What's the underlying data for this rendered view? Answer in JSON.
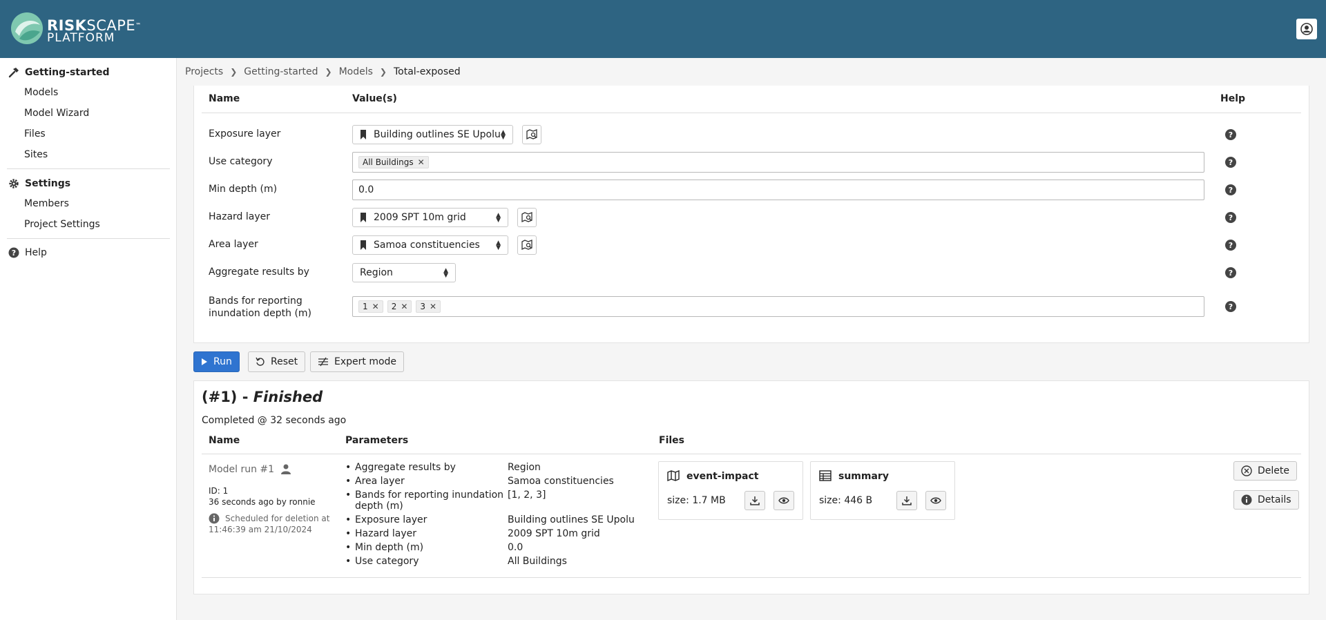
{
  "header": {
    "logo_word1": "RISK",
    "logo_word2": "SCAPE",
    "logo_tm": "™",
    "logo_line2": "PLATFORM"
  },
  "sidebar": {
    "project": "Getting-started",
    "project_items": [
      "Models",
      "Model Wizard",
      "Files",
      "Sites"
    ],
    "settings": "Settings",
    "settings_items": [
      "Members",
      "Project Settings"
    ],
    "help": "Help"
  },
  "breadcrumb": [
    "Projects",
    "Getting-started",
    "Models",
    "Total-exposed"
  ],
  "params_table": {
    "col_name": "Name",
    "col_values": "Value(s)",
    "col_help": "Help",
    "rows": {
      "exposure_layer": {
        "label": "Exposure layer",
        "value": "Building outlines SE Upolu"
      },
      "use_category": {
        "label": "Use category",
        "tags": [
          "All Buildings"
        ]
      },
      "min_depth": {
        "label": "Min depth (m)",
        "value": "0.0"
      },
      "hazard_layer": {
        "label": "Hazard layer",
        "value": "2009 SPT 10m grid"
      },
      "area_layer": {
        "label": "Area layer",
        "value": "Samoa constituencies"
      },
      "aggregate": {
        "label": "Aggregate results by",
        "value": "Region"
      },
      "bands": {
        "label_line1": "Bands for reporting",
        "label_line2": "inundation depth (m)",
        "tags": [
          "1",
          "2",
          "3"
        ]
      }
    },
    "help_glyph": "?"
  },
  "actions": {
    "run": "Run",
    "reset": "Reset",
    "expert": "Expert mode"
  },
  "run": {
    "title_prefix": "(#1) - ",
    "title_status": "Finished",
    "completed": "Completed @ 32 seconds ago",
    "col_name": "Name",
    "col_parameters": "Parameters",
    "col_files": "Files",
    "name": "Model run #1",
    "id": "ID: 1",
    "when": "36 seconds ago by ronnie",
    "deletion_line1": "Scheduled for deletion at",
    "deletion_line2": "11:46:39 am 21/10/2024",
    "parameters": [
      {
        "key": "Aggregate results by",
        "value": "Region"
      },
      {
        "key": "Area layer",
        "value": "Samoa constituencies"
      },
      {
        "key_line1": "Bands for reporting inundation",
        "key_line2": "depth (m)",
        "value": "[1, 2, 3]"
      },
      {
        "key": "Exposure layer",
        "value": "Building outlines SE Upolu"
      },
      {
        "key": "Hazard layer",
        "value": "2009 SPT 10m grid"
      },
      {
        "key": "Min depth (m)",
        "value": "0.0"
      },
      {
        "key": "Use category",
        "value": "All Buildings"
      }
    ],
    "files": [
      {
        "name": "event-impact",
        "size": "size: 1.7 MB",
        "icon": "map-icon"
      },
      {
        "name": "summary",
        "size": "size: 446 B",
        "icon": "table-icon"
      }
    ],
    "delete": "Delete",
    "details": "Details"
  },
  "colors": {
    "header": "#2e6482",
    "primary": "#2f74d0"
  }
}
